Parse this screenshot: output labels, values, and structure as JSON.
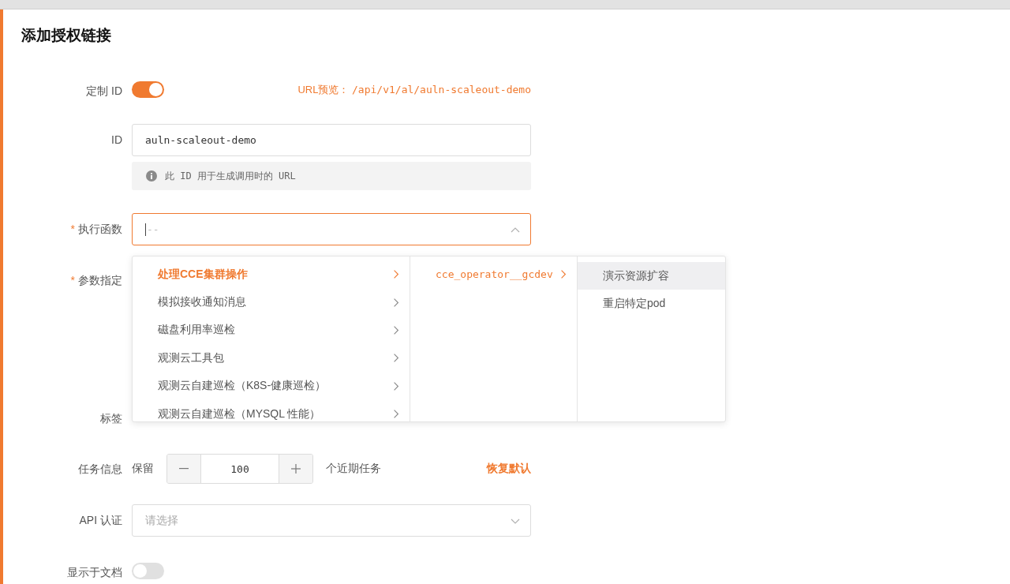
{
  "title": "添加授权链接",
  "custom_id": {
    "label": "定制 ID",
    "on": true,
    "url_preview_label": "URL预览：",
    "url_preview": "/api/v1/al/auln-scaleout-demo"
  },
  "id_field": {
    "label": "ID",
    "value": "auln-scaleout-demo",
    "hint": "此 ID 用于生成调用时的 URL"
  },
  "function_field": {
    "label": "执行函数",
    "required_mark": "*",
    "placeholder": "--",
    "focused": true
  },
  "cascader": [
    {
      "items": [
        {
          "label": "处理CCE集群操作",
          "selected": true,
          "hover": false,
          "has_children": true
        },
        {
          "label": "模拟接收通知消息",
          "selected": false,
          "hover": false,
          "has_children": true
        },
        {
          "label": "磁盘利用率巡检",
          "selected": false,
          "hover": false,
          "has_children": true
        },
        {
          "label": "观测云工具包",
          "selected": false,
          "hover": false,
          "has_children": true
        },
        {
          "label": "观测云自建巡检（K8S-健康巡检）",
          "selected": false,
          "hover": false,
          "has_children": true
        },
        {
          "label": "观测云自建巡检（MYSQL 性能）",
          "selected": false,
          "hover": false,
          "has_children": true
        }
      ]
    },
    {
      "items": [
        {
          "label": "cce_operator__gcdev",
          "selected": true,
          "hover": false,
          "has_children": true
        }
      ]
    },
    {
      "items": [
        {
          "label": "演示资源扩容",
          "selected": false,
          "hover": true,
          "has_children": false
        },
        {
          "label": "重启特定pod",
          "selected": false,
          "hover": false,
          "has_children": false
        }
      ]
    }
  ],
  "params_field": {
    "label": "参数指定",
    "required_mark": "*"
  },
  "tags_field": {
    "label": "标签"
  },
  "task_info": {
    "label": "任务信息",
    "prefix": "保留",
    "value": "100",
    "suffix": "个近期任务",
    "reset": "恢复默认"
  },
  "api_auth": {
    "label": "API 认证",
    "placeholder": "请选择"
  },
  "show_in_docs": {
    "label": "显示于文档",
    "on": false
  }
}
